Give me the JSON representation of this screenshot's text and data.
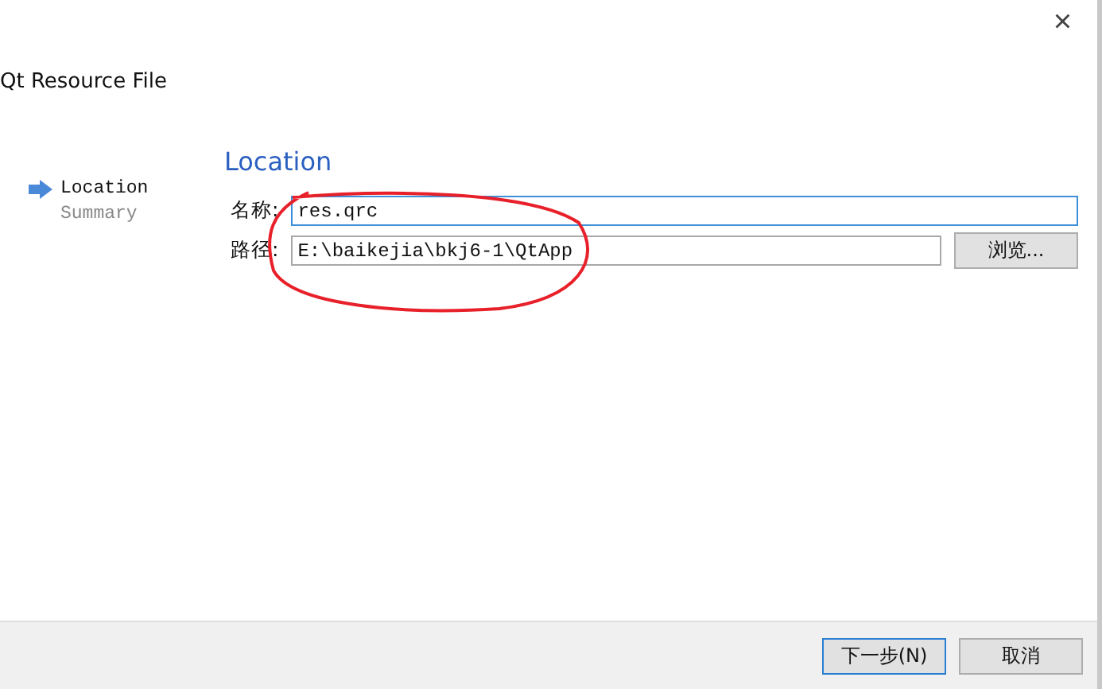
{
  "window": {
    "title": "Qt Resource File",
    "close": "×"
  },
  "steps": [
    {
      "label": "Location",
      "selected": true
    },
    {
      "label": "Summary",
      "selected": false
    }
  ],
  "page": {
    "heading": "Location",
    "fields": [
      {
        "kind": "text",
        "label": "名称:",
        "value": "res.qrc",
        "focused": true
      },
      {
        "kind": "path",
        "label": "路径:",
        "value": "E:\\baikejia\\bkj6-1\\QtApp",
        "focused": false,
        "button": "浏览..."
      }
    ]
  },
  "buttons": [
    {
      "label": "下一步(N)",
      "default": true
    },
    {
      "label": "取消",
      "default": false
    }
  ]
}
